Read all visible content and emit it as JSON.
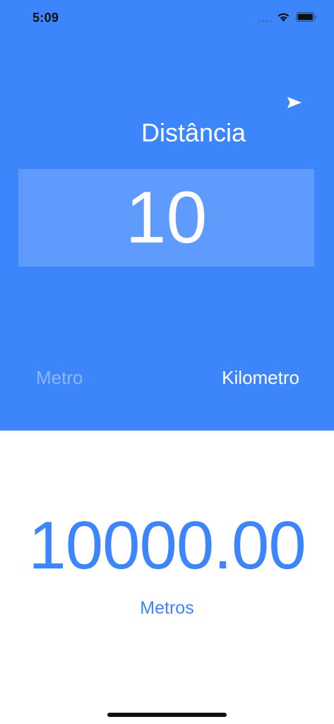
{
  "status_bar": {
    "time": "5:09"
  },
  "header": {
    "title": "Distância"
  },
  "input": {
    "value": "10"
  },
  "units": {
    "from_label": "Metro",
    "to_label": "Kilometro"
  },
  "result": {
    "value": "10000.00",
    "unit": "Metros"
  },
  "icons": {
    "send": "paper-plane-icon",
    "wifi": "wifi-icon",
    "battery": "battery-icon",
    "signal": "signal-icon"
  },
  "colors": {
    "accent": "#3c85fb",
    "input_box": "#5e9bfd",
    "inactive_unit": "#8cb7fc",
    "background": "#ffffff"
  }
}
